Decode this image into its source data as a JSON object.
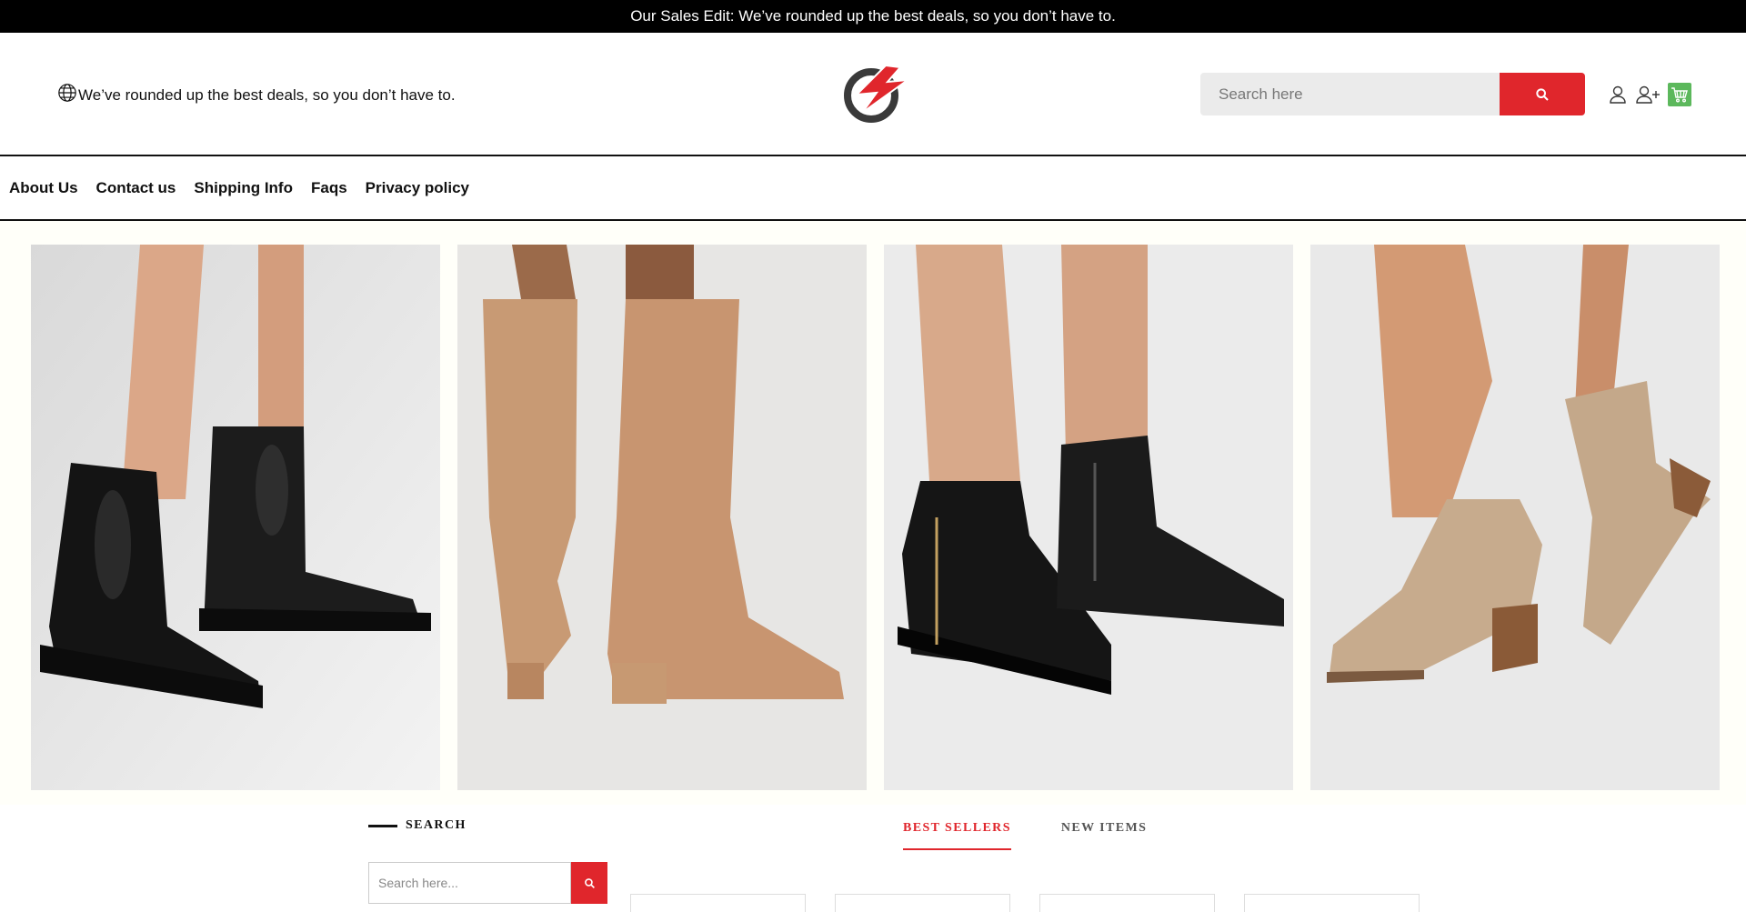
{
  "topbar": {
    "text": "Our Sales Edit: We’ve rounded up the best deals, so you don’t have to."
  },
  "header": {
    "tagline": "We’ve rounded up the best deals, so you don’t have to.",
    "search_placeholder": "Search here",
    "icons": [
      "globe-icon",
      "logo-icon",
      "search-icon",
      "user-icon",
      "add-user-icon",
      "cart-icon"
    ]
  },
  "nav": {
    "items": [
      {
        "label": "About Us"
      },
      {
        "label": "Contact us"
      },
      {
        "label": "Shipping Info"
      },
      {
        "label": "Faqs"
      },
      {
        "label": "Privacy policy"
      }
    ]
  },
  "banner": {
    "images": [
      "black-chelsea-boots",
      "tan-knee-high-boots",
      "black-zip-ankle-boots",
      "beige-heeled-ankle-boots"
    ]
  },
  "sidebar": {
    "search_title": "SEARCH",
    "search_placeholder": "Search here..."
  },
  "tabs": [
    {
      "label": "BEST SELLERS",
      "active": true
    },
    {
      "label": "NEW ITEMS",
      "active": false
    }
  ],
  "colors": {
    "accent": "#e0262c",
    "cart": "#5cb85c",
    "topbar": "#000000"
  }
}
